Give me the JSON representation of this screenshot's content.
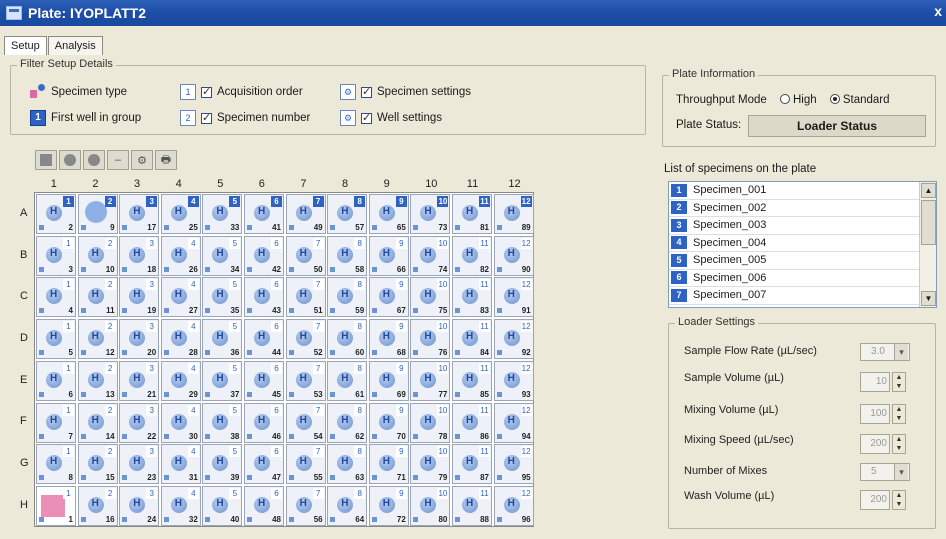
{
  "window": {
    "title": "Plate: IYOPLATT2",
    "close_glyph": "x"
  },
  "tabs": [
    {
      "label": "Setup",
      "active": true
    },
    {
      "label": "Analysis",
      "active": false
    }
  ],
  "filter": {
    "legend": "Filter Setup Details",
    "specimen_type": "Specimen type",
    "first_well": "First well in group",
    "acquisition_order": "Acquisition order",
    "specimen_number": "Specimen number",
    "specimen_settings": "Specimen settings",
    "well_settings": "Well settings"
  },
  "plate": {
    "columns": [
      "1",
      "2",
      "3",
      "4",
      "5",
      "6",
      "7",
      "8",
      "9",
      "10",
      "11",
      "12"
    ],
    "rows": [
      "A",
      "B",
      "C",
      "D",
      "E",
      "F",
      "G",
      "H"
    ],
    "row_a_badges": [
      "1",
      "2",
      "3",
      "4",
      "5",
      "6",
      "7",
      "8",
      "9",
      "10",
      "11",
      "12"
    ],
    "acq_rows": [
      [
        "2",
        "9",
        "17",
        "25",
        "33",
        "41",
        "49",
        "57",
        "65",
        "73",
        "81",
        "89"
      ],
      [
        "3",
        "10",
        "18",
        "26",
        "34",
        "42",
        "50",
        "58",
        "66",
        "74",
        "82",
        "90"
      ],
      [
        "4",
        "11",
        "19",
        "27",
        "35",
        "43",
        "51",
        "59",
        "67",
        "75",
        "83",
        "91"
      ],
      [
        "5",
        "12",
        "20",
        "28",
        "36",
        "44",
        "52",
        "60",
        "68",
        "76",
        "84",
        "92"
      ],
      [
        "6",
        "13",
        "21",
        "29",
        "37",
        "45",
        "53",
        "61",
        "69",
        "77",
        "85",
        "93"
      ],
      [
        "7",
        "14",
        "22",
        "30",
        "38",
        "46",
        "54",
        "62",
        "70",
        "78",
        "86",
        "94"
      ],
      [
        "8",
        "15",
        "23",
        "31",
        "39",
        "47",
        "55",
        "63",
        "71",
        "79",
        "87",
        "95"
      ],
      [
        "1",
        "16",
        "24",
        "32",
        "40",
        "48",
        "56",
        "64",
        "72",
        "80",
        "88",
        "96"
      ]
    ]
  },
  "plate_info": {
    "legend": "Plate Information",
    "throughput_label": "Throughput Mode",
    "high_label": "High",
    "standard_label": "Standard",
    "throughput_selected": "Standard",
    "status_label": "Plate Status:",
    "status_value": "Loader Status"
  },
  "specimens": {
    "label": "List of specimens on the plate",
    "items": [
      {
        "num": "1",
        "name": "Specimen_001"
      },
      {
        "num": "2",
        "name": "Specimen_002"
      },
      {
        "num": "3",
        "name": "Specimen_003"
      },
      {
        "num": "4",
        "name": "Specimen_004"
      },
      {
        "num": "5",
        "name": "Specimen_005"
      },
      {
        "num": "6",
        "name": "Specimen_006"
      },
      {
        "num": "7",
        "name": "Specimen_007"
      }
    ]
  },
  "loader": {
    "legend": "Loader Settings",
    "flow_rate_label": "Sample Flow Rate (µL/sec)",
    "flow_rate_value": "3.0",
    "sample_volume_label": "Sample Volume (µL)",
    "sample_volume_value": "10",
    "mixing_volume_label": "Mixing Volume (µL)",
    "mixing_volume_value": "100",
    "mixing_speed_label": "Mixing Speed (µL/sec)",
    "mixing_speed_value": "200",
    "num_mixes_label": "Number of Mixes",
    "num_mixes_value": "5",
    "wash_volume_label": "Wash Volume (µL)",
    "wash_volume_value": "200"
  },
  "colors": {
    "title_bar": "#1d4ea6",
    "accent_blue": "#2e63c3",
    "pink_well": "#ec8fb8"
  }
}
